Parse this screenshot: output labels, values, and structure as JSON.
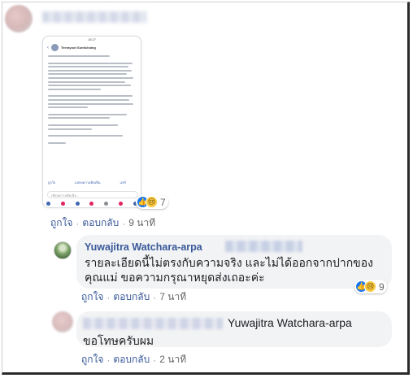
{
  "post": {
    "reaction_count": "7",
    "actions": {
      "like": "ถูกใจ",
      "reply": "ตอบกลับ",
      "time": "9 นาที"
    }
  },
  "phone_preview": {
    "status_left": "",
    "status_time": "18:27",
    "author": "Teerayoot Suntichaing",
    "like_label": "ถูกใจ",
    "comment_label": "แสดงความคิดเห็น",
    "share_label": "แชร์",
    "input_placeholder": "เขียนความคิดเห็น..."
  },
  "reply1": {
    "author": "Yuwajitra Watchara-arpa",
    "text": "รายละเอียดนี้ไม่ตรงกับความจริง และไม่ได้ออกจากปากของคุณแม่ ขอความกรุณาหยุดส่งเถอะค่ะ",
    "reaction_count": "9",
    "actions": {
      "like": "ถูกใจ",
      "reply": "ตอบกลับ",
      "time": "7 นาที"
    }
  },
  "reply2": {
    "tag": "Yuwajitra Watchara-arpa",
    "text": "ขอโทษครับผม",
    "actions": {
      "like": "ถูกใจ",
      "reply": "ตอบกลับ",
      "time": "2 นาที"
    }
  },
  "colors": {
    "link": "#385898",
    "like": "#1877f2",
    "bubble": "#f2f3f5"
  }
}
